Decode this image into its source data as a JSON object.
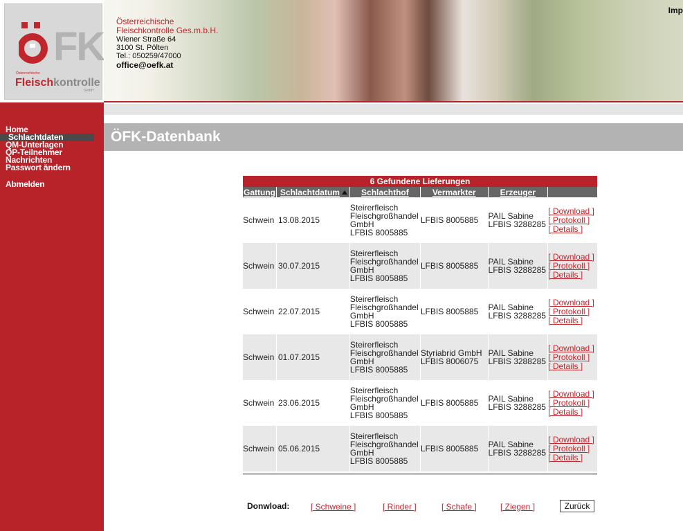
{
  "header": {
    "company_line1": "Österreichische",
    "company_line2": "Fleischkontrolle Ges.m.b.H.",
    "street": "Wiener Straße 64",
    "city": "3100 St. Pölten",
    "phone": "Tel.: 050259/47000",
    "email": "office@oefk.at",
    "top_right_link": "Imp"
  },
  "logo": {
    "small_text": "Österreichische",
    "brand_part1": "Fleisch",
    "brand_part2": "kontrolle",
    "gmbh": "GmbH"
  },
  "sidebar": {
    "items": [
      {
        "label": "Home"
      },
      {
        "label": "Schlachtdaten"
      },
      {
        "label": "QM-Unterlagen"
      },
      {
        "label": "QP-Teilnehmer"
      },
      {
        "label": "Nachrichten"
      },
      {
        "label": "Passwort ändern"
      },
      {
        "label": "Abmelden"
      }
    ]
  },
  "page_title": "ÖFK-Datenbank",
  "results": {
    "heading": "6 Gefundene Lieferungen",
    "columns": [
      "Gattung",
      "Schlachtdatum",
      "Schlachthof",
      "Vermarkter",
      "Erzeuger"
    ],
    "actions": [
      "[ Download ]",
      "[ Protokoll ]",
      "[ Details ]"
    ],
    "rows": [
      {
        "gattung": "Schwein",
        "datum": "13.08.2015",
        "hof": [
          "Steirerfleisch",
          "Fleischgroßhandel",
          "GmbH",
          "LFBIS 8005885"
        ],
        "verm": [
          "LFBIS 8005885"
        ],
        "erz": [
          "PAIL Sabine",
          "LFBIS 3288285"
        ]
      },
      {
        "gattung": "Schwein",
        "datum": "30.07.2015",
        "hof": [
          "Steirerfleisch",
          "Fleischgroßhandel",
          "GmbH",
          "LFBIS 8005885"
        ],
        "verm": [
          "LFBIS 8005885"
        ],
        "erz": [
          "PAIL Sabine",
          "LFBIS 3288285"
        ]
      },
      {
        "gattung": "Schwein",
        "datum": "22.07.2015",
        "hof": [
          "Steirerfleisch",
          "Fleischgroßhandel",
          "GmbH",
          "LFBIS 8005885"
        ],
        "verm": [
          "LFBIS 8005885"
        ],
        "erz": [
          "PAIL Sabine",
          "LFBIS 3288285"
        ]
      },
      {
        "gattung": "Schwein",
        "datum": "01.07.2015",
        "hof": [
          "Steirerfleisch",
          "Fleischgroßhandel",
          "GmbH",
          "LFBIS 8005885"
        ],
        "verm": [
          "Styriabrid GmbH",
          "LFBIS 8006075"
        ],
        "erz": [
          "PAIL Sabine",
          "LFBIS 3288285"
        ]
      },
      {
        "gattung": "Schwein",
        "datum": "23.06.2015",
        "hof": [
          "Steirerfleisch",
          "Fleischgroßhandel",
          "GmbH",
          "LFBIS 8005885"
        ],
        "verm": [
          "LFBIS 8005885"
        ],
        "erz": [
          "PAIL Sabine",
          "LFBIS 3288285"
        ]
      },
      {
        "gattung": "Schwein",
        "datum": "05.06.2015",
        "hof": [
          "Steirerfleisch",
          "Fleischgroßhandel",
          "GmbH",
          "LFBIS 8005885"
        ],
        "verm": [
          "LFBIS 8005885"
        ],
        "erz": [
          "PAIL Sabine",
          "LFBIS 3288285"
        ]
      }
    ]
  },
  "download": {
    "label": "Donwload:",
    "links": [
      "[ Schweine ]",
      "[ Rinder ]",
      "[ Schafe ]",
      "[ Ziegen ]"
    ],
    "back_button": "Zurück"
  },
  "colors": {
    "brand_red": "#b8232a",
    "header_grey": "#666666",
    "title_grey": "#b3b3b3"
  }
}
